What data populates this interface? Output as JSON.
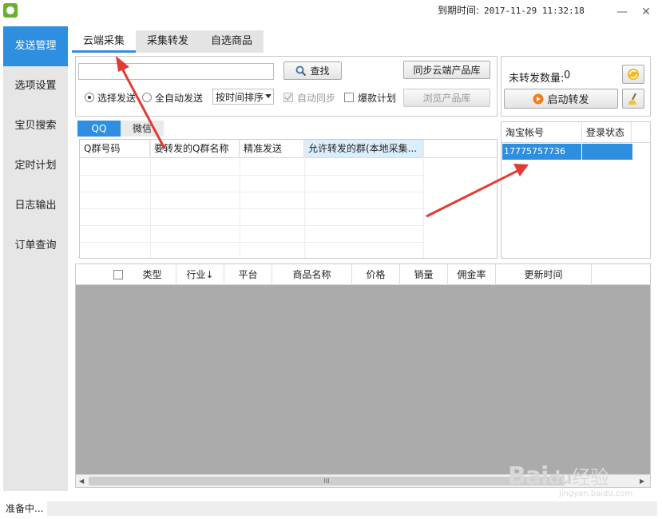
{
  "header": {
    "expiry_label": "到期时间:",
    "expiry_value": "2017-11-29 11:32:18",
    "minimize_glyph": "—",
    "close_glyph": "✕"
  },
  "sidebar": {
    "items": [
      {
        "label": "发送管理",
        "active": true
      },
      {
        "label": "选项设置"
      },
      {
        "label": "宝贝搜索"
      },
      {
        "label": "定时计划"
      },
      {
        "label": "日志输出"
      },
      {
        "label": "订单查询"
      }
    ]
  },
  "tabs": [
    {
      "label": "云端采集",
      "active": true
    },
    {
      "label": "采集转发"
    },
    {
      "label": "自选商品"
    }
  ],
  "search": {
    "value": "",
    "button_label": "查找",
    "sync_button": "同步云端产品库",
    "browse_button": "浏览产品库"
  },
  "options": {
    "radio_selected": "选择发送",
    "radio_auto": "全自动发送",
    "sort_select": "按时间排序",
    "auto_sync": "自动同步",
    "hot_plan": "爆款计划"
  },
  "forward": {
    "count_label": "未转发数量:",
    "count_value": "0",
    "start_button": "启动转发"
  },
  "group_tabs": [
    {
      "label": "QQ",
      "active": true
    },
    {
      "label": "微信"
    }
  ],
  "group_table": {
    "columns": [
      "Q群号码",
      "要转发的Q群名称",
      "精准发送",
      "允许转发的群(本地采集..."
    ]
  },
  "account_table": {
    "columns": [
      "淘宝帐号",
      "登录状态"
    ],
    "rows": [
      [
        "17775757736",
        ""
      ]
    ]
  },
  "product_table": {
    "columns": [
      "类型",
      "行业↓",
      "平台",
      "商品名称",
      "价格",
      "销量",
      "佣金率",
      "更新时间"
    ],
    "scroll_thumb": "III"
  },
  "status": {
    "text": "准备中..."
  },
  "watermark": {
    "brand": "Bai",
    "paw": "du",
    "suffix": "经验",
    "url": "jingyan.baidu.com"
  },
  "colors": {
    "accent": "#2e8fe0",
    "arrow": "#e23b33",
    "gray_area": "#ababab"
  }
}
